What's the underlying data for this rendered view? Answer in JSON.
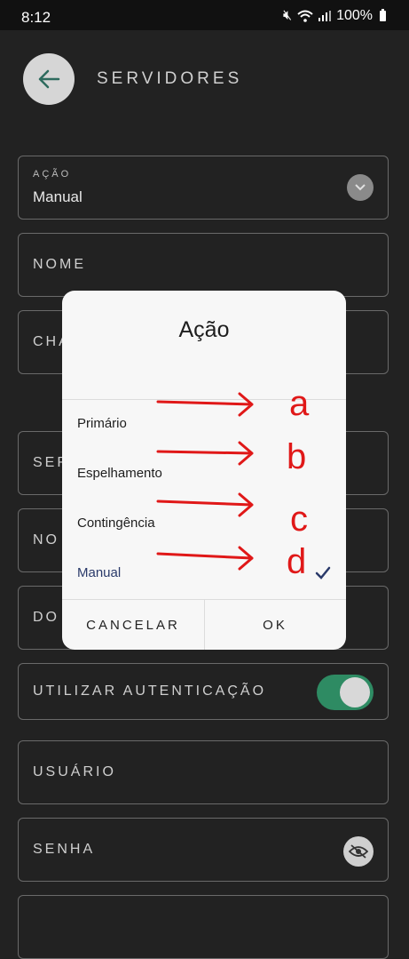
{
  "status_bar": {
    "time": "8:12",
    "battery": "100%"
  },
  "header": {
    "title": "SERVIDORES"
  },
  "fields": {
    "acao": {
      "label": "AÇÃO",
      "value": "Manual"
    },
    "nome": {
      "label": "NOME"
    },
    "chave": {
      "label": "CHA"
    },
    "servidor": {
      "label": "SER"
    },
    "nome2": {
      "label": "NO"
    },
    "dominio": {
      "label": "DO"
    },
    "autenticacao": {
      "label": "UTILIZAR AUTENTICAÇÃO",
      "enabled": true
    },
    "usuario": {
      "label": "USUÁRIO"
    },
    "senha": {
      "label": "SENHA"
    }
  },
  "dialog": {
    "title": "Ação",
    "options": [
      {
        "label": "Primário",
        "selected": false
      },
      {
        "label": "Espelhamento",
        "selected": false
      },
      {
        "label": "Contingência",
        "selected": false
      },
      {
        "label": "Manual",
        "selected": true
      }
    ],
    "cancel_label": "CANCELAR",
    "ok_label": "OK"
  },
  "annotations": {
    "letters": [
      "a",
      "b",
      "c",
      "d"
    ],
    "color": "#e01818"
  },
  "colors": {
    "background": "#222222",
    "toggle_on": "#2e8b63",
    "dialog_bg": "#f7f7f7"
  }
}
